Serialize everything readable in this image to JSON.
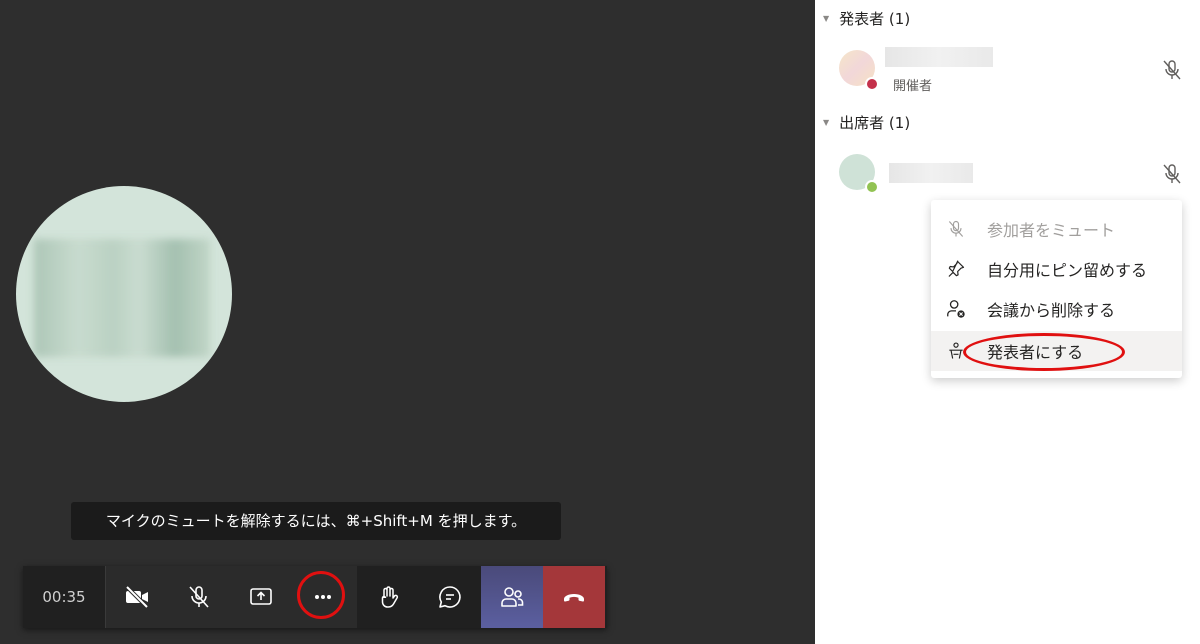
{
  "tooltip": {
    "text": "マイクのミュートを解除するには、⌘+Shift+M を押します。"
  },
  "toolbar": {
    "timer": "00:35"
  },
  "panel": {
    "presenters_header": "発表者 (1)",
    "attendees_header": "出席者 (1)",
    "organizer_role": "開催者"
  },
  "context_menu": {
    "items": [
      {
        "label": "参加者をミュート",
        "icon": "mic-off-icon",
        "state": "disabled"
      },
      {
        "label": "自分用にピン留めする",
        "icon": "pin-icon",
        "state": "normal"
      },
      {
        "label": "会議から削除する",
        "icon": "remove-person-icon",
        "state": "normal"
      },
      {
        "label": "発表者にする",
        "icon": "presenter-icon",
        "state": "hover"
      }
    ]
  },
  "colors": {
    "hangup": "#a4373a",
    "people_active": "#5b5fa0",
    "annotation": "#e01010",
    "status_busy": "#c4314b",
    "status_available": "#92c353"
  }
}
